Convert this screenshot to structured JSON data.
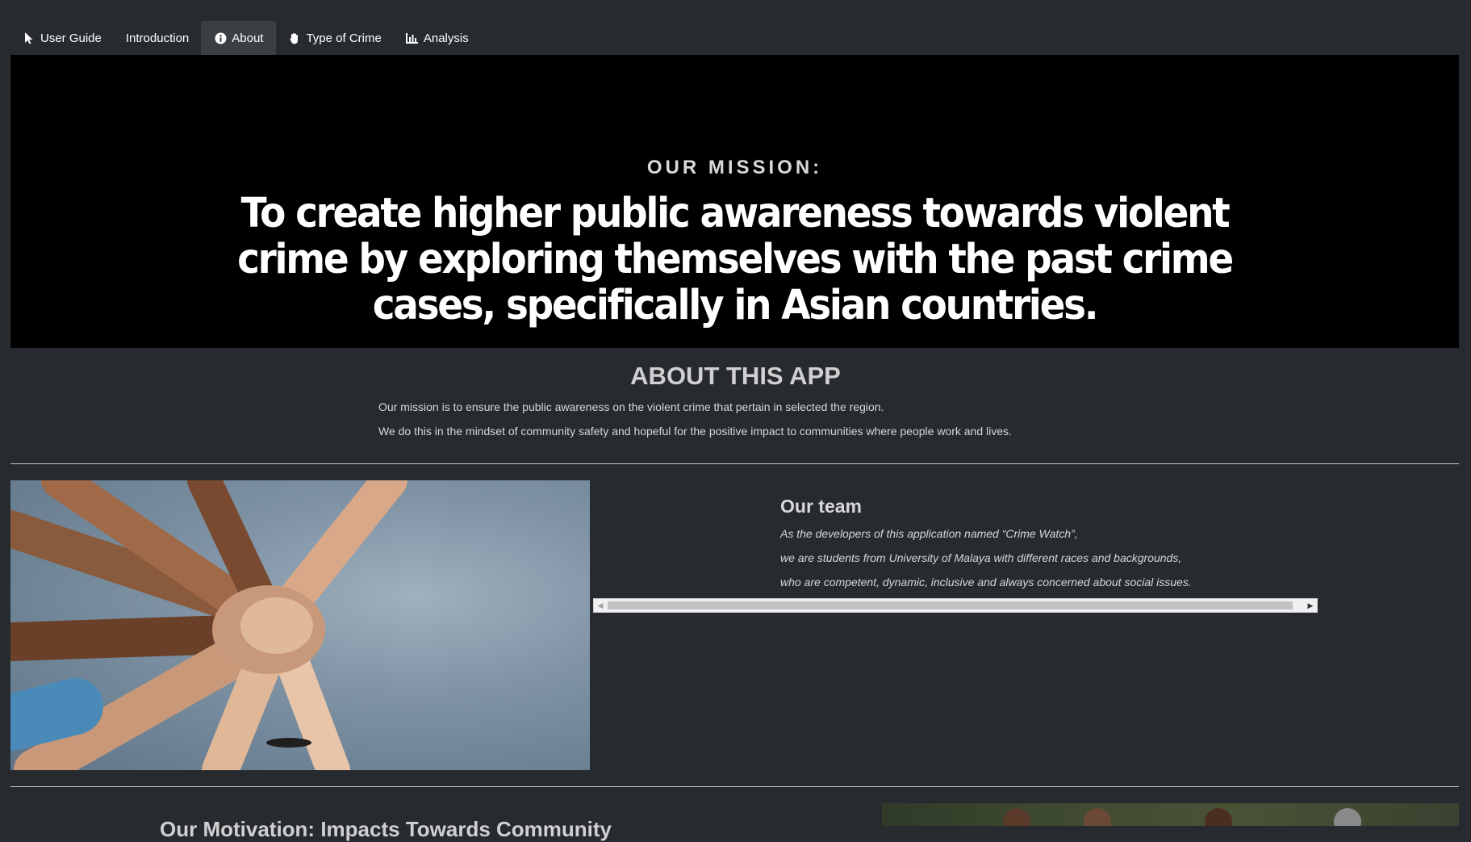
{
  "nav": {
    "tabs": [
      {
        "label": "User Guide",
        "icon": "cursor-icon",
        "active": false
      },
      {
        "label": "Introduction",
        "icon": "",
        "active": false
      },
      {
        "label": "About",
        "icon": "info-circle-icon",
        "active": true
      },
      {
        "label": "Type of Crime",
        "icon": "hand-paper-icon",
        "active": false
      },
      {
        "label": "Analysis",
        "icon": "bar-chart-icon",
        "active": false
      }
    ]
  },
  "banner": {
    "kicker": "OUR MISSION:",
    "mission": "To create higher public awareness towards violent crime by exploring themselves with the past crime cases, specifically in Asian countries."
  },
  "about": {
    "title": "ABOUT THIS APP",
    "lines": [
      "Our mission is to ensure the public awareness on the violent crime that pertain in selected the region.",
      "We do this in the mindset of community safety and hopeful for the positive impact to communities where people work and lives."
    ]
  },
  "team": {
    "title": "Our team",
    "lines": [
      "As the developers of this application named “Crime Watch”,",
      "we are students from University of Malaya with different races and backgrounds,",
      "who are competent, dynamic, inclusive and always concerned about social issues."
    ]
  },
  "next_section": {
    "title": "Our Motivation: Impacts Towards Community"
  },
  "colors": {
    "background": "#272b30",
    "banner": "#000000",
    "active_tab": "#3a3f44"
  }
}
